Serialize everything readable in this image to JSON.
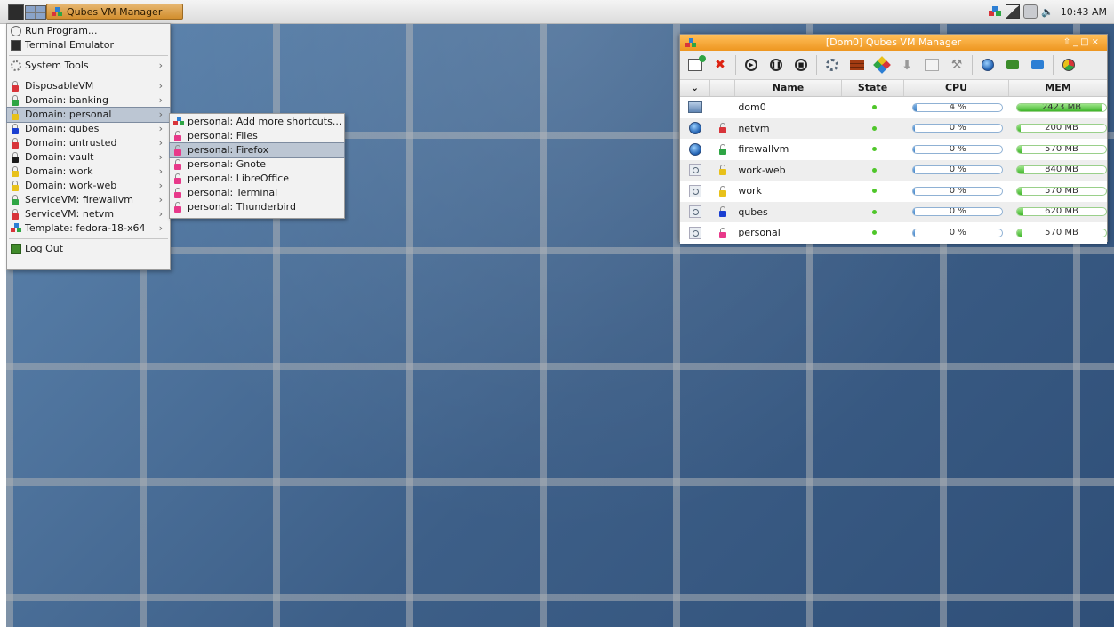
{
  "panel": {
    "task_button_label": "Qubes VM Manager",
    "clock": "10:43 AM"
  },
  "start_menu": {
    "items": [
      {
        "label": "Run Program...",
        "icon": "run-icon"
      },
      {
        "label": "Terminal Emulator",
        "icon": "terminal-icon"
      },
      {
        "label": "System Tools",
        "icon": "gear-icon"
      },
      {
        "label": "DisposableVM",
        "icon": "lock-icon",
        "color": "#d8343a"
      },
      {
        "label": "Domain: banking",
        "icon": "lock-icon",
        "color": "#2ea544"
      },
      {
        "label": "Domain: personal",
        "icon": "lock-icon",
        "color": "#e8c11a"
      },
      {
        "label": "Domain: qubes",
        "icon": "lock-icon",
        "color": "#1a3fd1"
      },
      {
        "label": "Domain: untrusted",
        "icon": "lock-icon",
        "color": "#d8343a"
      },
      {
        "label": "Domain: vault",
        "icon": "lock-icon",
        "color": "#1a1a1a"
      },
      {
        "label": "Domain: work",
        "icon": "lock-icon",
        "color": "#e8c11a"
      },
      {
        "label": "Domain: work-web",
        "icon": "lock-icon",
        "color": "#e8c11a"
      },
      {
        "label": "ServiceVM: firewallvm",
        "icon": "lock-icon",
        "color": "#2ea544"
      },
      {
        "label": "ServiceVM: netvm",
        "icon": "lock-icon",
        "color": "#d8343a"
      },
      {
        "label": "Template: fedora-18-x64",
        "icon": "qubes-icon"
      },
      {
        "label": "Log Out",
        "icon": "logout-icon"
      }
    ]
  },
  "submenu": {
    "items": [
      {
        "label": "personal: Add more shortcuts...",
        "icon": "qubes-icon"
      },
      {
        "label": "personal: Files",
        "icon": "lock-icon"
      },
      {
        "label": "personal: Firefox",
        "icon": "lock-icon"
      },
      {
        "label": "personal: Gnote",
        "icon": "lock-icon"
      },
      {
        "label": "personal: LibreOffice",
        "icon": "lock-icon"
      },
      {
        "label": "personal: Terminal",
        "icon": "lock-icon"
      },
      {
        "label": "personal: Thunderbird",
        "icon": "lock-icon"
      }
    ]
  },
  "vm_manager": {
    "title": "[Dom0] Qubes VM Manager",
    "columns": {
      "expand": "⌄",
      "name": "Name",
      "state": "State",
      "cpu": "CPU",
      "mem": "MEM"
    },
    "rows": [
      {
        "name": "dom0",
        "type_icon": "monitor-icon",
        "lock_color": "",
        "state": "running",
        "cpu": "4 %",
        "cpu_value": 0.04,
        "mem": "2423 MB",
        "mem_fraction": 0.95
      },
      {
        "name": "netvm",
        "type_icon": "globe-icon",
        "lock_color": "#d8343a",
        "state": "running",
        "cpu": "0 %",
        "cpu_value": 0.0,
        "mem": "200 MB",
        "mem_fraction": 0.04
      },
      {
        "name": "firewallvm",
        "type_icon": "globe-icon",
        "lock_color": "#2ea544",
        "state": "running",
        "cpu": "0 %",
        "cpu_value": 0.0,
        "mem": "570 MB",
        "mem_fraction": 0.06
      },
      {
        "name": "work-web",
        "type_icon": "appvm-icon",
        "lock_color": "#e8c11a",
        "state": "running",
        "cpu": "0 %",
        "cpu_value": 0.0,
        "mem": "840 MB",
        "mem_fraction": 0.08
      },
      {
        "name": "work",
        "type_icon": "appvm-icon",
        "lock_color": "#e8c11a",
        "state": "running",
        "cpu": "0 %",
        "cpu_value": 0.0,
        "mem": "570 MB",
        "mem_fraction": 0.06
      },
      {
        "name": "qubes",
        "type_icon": "appvm-icon",
        "lock_color": "#1a3fd1",
        "state": "running",
        "cpu": "0 %",
        "cpu_value": 0.0,
        "mem": "620 MB",
        "mem_fraction": 0.07
      },
      {
        "name": "personal",
        "type_icon": "appvm-icon",
        "lock_color": "#e8398a",
        "state": "running",
        "cpu": "0 %",
        "cpu_value": 0.0,
        "mem": "570 MB",
        "mem_fraction": 0.06
      }
    ]
  }
}
